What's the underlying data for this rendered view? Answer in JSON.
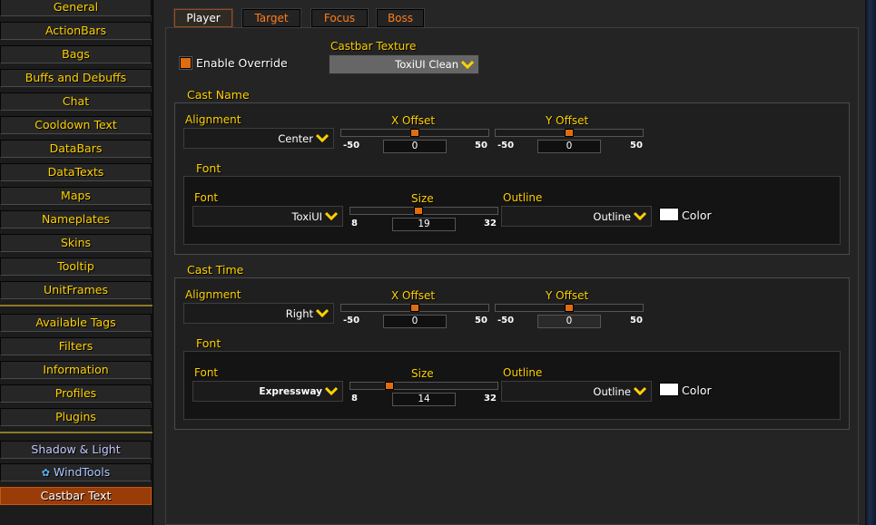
{
  "sidebar": {
    "items": [
      {
        "label": "General"
      },
      {
        "label": "ActionBars"
      },
      {
        "label": "Bags"
      },
      {
        "label": "Buffs and Debuffs"
      },
      {
        "label": "Chat"
      },
      {
        "label": "Cooldown Text"
      },
      {
        "label": "DataBars"
      },
      {
        "label": "DataTexts"
      },
      {
        "label": "Maps"
      },
      {
        "label": "Nameplates"
      },
      {
        "label": "Skins"
      },
      {
        "label": "Tooltip"
      },
      {
        "label": "UnitFrames"
      },
      {
        "label": "Available Tags"
      },
      {
        "label": "Filters"
      },
      {
        "label": "Information"
      },
      {
        "label": "Profiles"
      },
      {
        "label": "Plugins"
      },
      {
        "label": "Shadow & Light"
      },
      {
        "label": "WindTools"
      },
      {
        "label": "Castbar Text"
      }
    ],
    "windtools_icon": "gear-cluster-icon",
    "active_item": "Castbar Text"
  },
  "tabs": [
    {
      "label": "Player"
    },
    {
      "label": "Target"
    },
    {
      "label": "Focus"
    },
    {
      "label": "Boss"
    }
  ],
  "selected_tab": "Player",
  "enable_override": {
    "label": "Enable Override",
    "checked": true
  },
  "castbar_texture": {
    "label": "Castbar Texture",
    "value": "ToxiUI Clean"
  },
  "cast_name": {
    "title": "Cast Name",
    "alignment": {
      "label": "Alignment",
      "value": "Center"
    },
    "x_offset": {
      "label": "X Offset",
      "min": "-50",
      "max": "50",
      "value": "0",
      "level": 0.5
    },
    "y_offset": {
      "label": "Y Offset",
      "min": "-50",
      "max": "50",
      "value": "0",
      "level": 0.5
    },
    "font_group": {
      "title": "Font",
      "font": {
        "label": "Font",
        "value": "ToxiUI"
      },
      "size": {
        "label": "Size",
        "min": "8",
        "max": "32",
        "value": "19",
        "level": 0.458
      },
      "outline": {
        "label": "Outline",
        "value": "Outline"
      },
      "color": {
        "label": "Color",
        "swatch": "#ffffff"
      }
    }
  },
  "cast_time": {
    "title": "Cast Time",
    "alignment": {
      "label": "Alignment",
      "value": "Right"
    },
    "x_offset": {
      "label": "X Offset",
      "min": "-50",
      "max": "50",
      "value": "0",
      "level": 0.5
    },
    "y_offset": {
      "label": "Y Offset",
      "min": "-50",
      "max": "50",
      "value": "0",
      "level": 0.5
    },
    "font_group": {
      "title": "Font",
      "font": {
        "label": "Font",
        "value": "Expressway"
      },
      "size": {
        "label": "Size",
        "min": "8",
        "max": "32",
        "value": "14",
        "level": 0.25
      },
      "outline": {
        "label": "Outline",
        "value": "Outline"
      },
      "color": {
        "label": "Color",
        "swatch": "#ffffff"
      }
    }
  },
  "colors": {
    "accent": "#e06c10",
    "label_gold": "#ffd100",
    "tab_orange": "#ff7d1a",
    "active_bg": "#9a3c08"
  }
}
